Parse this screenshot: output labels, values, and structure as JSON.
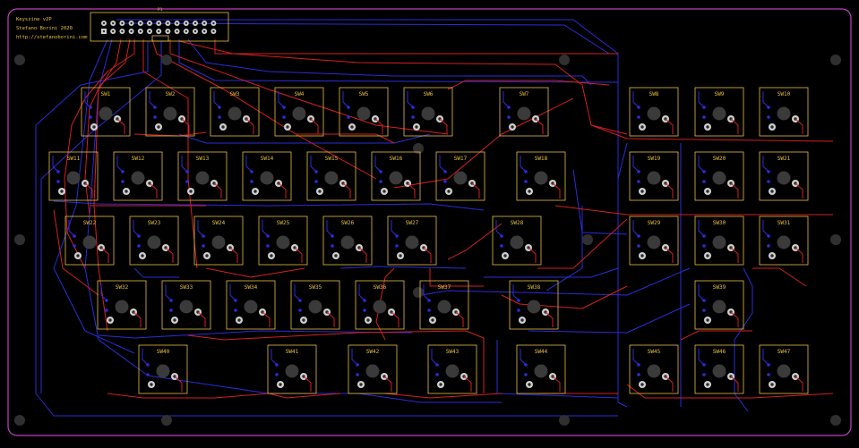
{
  "board": {
    "title_lines": [
      "Keyszine v2P",
      "Stefano Borini 2020",
      "http://stefanoborini.com"
    ],
    "connector_label": "P1",
    "colors": {
      "background": "#000000",
      "outline": "#c040c0",
      "top_copper": "#d42020",
      "bottom_copper": "#2c2cd8",
      "silk": "#e8c040",
      "pad": "#cfcfcf",
      "hole": "#2a2a2a",
      "mount_hole": "#303030"
    }
  },
  "switches": [
    {
      "label": "SW1"
    },
    {
      "label": "SW2"
    },
    {
      "label": "SW3"
    },
    {
      "label": "SW4"
    },
    {
      "label": "SW5"
    },
    {
      "label": "SW6"
    },
    {
      "label": "SW7"
    },
    {
      "label": "SW8"
    },
    {
      "label": "SW9"
    },
    {
      "label": "SW10"
    },
    {
      "label": "SW11"
    },
    {
      "label": "SW12"
    },
    {
      "label": "SW13"
    },
    {
      "label": "SW14"
    },
    {
      "label": "SW15"
    },
    {
      "label": "SW16"
    },
    {
      "label": "SW17"
    },
    {
      "label": "SW18"
    },
    {
      "label": "SW19"
    },
    {
      "label": "SW20"
    },
    {
      "label": "SW21"
    },
    {
      "label": "SW22"
    },
    {
      "label": "SW23"
    },
    {
      "label": "SW24"
    },
    {
      "label": "SW25"
    },
    {
      "label": "SW26"
    },
    {
      "label": "SW27"
    },
    {
      "label": "SW28"
    },
    {
      "label": "SW29"
    },
    {
      "label": "SW30"
    },
    {
      "label": "SW31"
    },
    {
      "label": "SW32"
    },
    {
      "label": "SW33"
    },
    {
      "label": "SW34"
    },
    {
      "label": "SW35"
    },
    {
      "label": "SW36"
    },
    {
      "label": "SW37"
    },
    {
      "label": "SW38"
    },
    {
      "label": "SW39"
    },
    {
      "label": "SW40"
    },
    {
      "label": "SW41"
    },
    {
      "label": "SW42"
    },
    {
      "label": "SW43"
    },
    {
      "label": "SW44"
    },
    {
      "label": "SW45"
    },
    {
      "label": "SW46"
    },
    {
      "label": "SW47"
    }
  ]
}
